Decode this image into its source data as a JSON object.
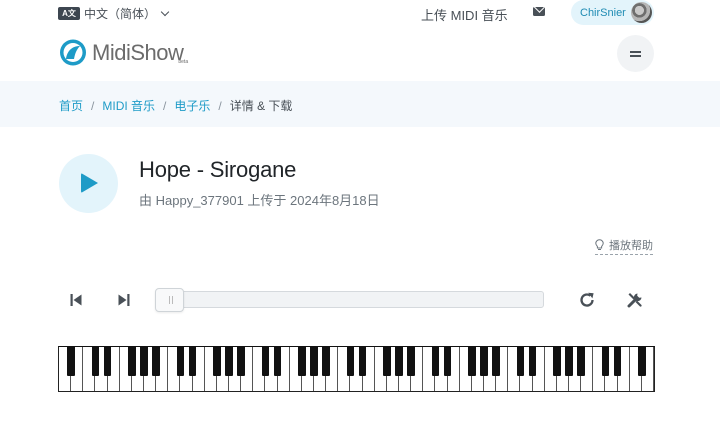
{
  "topbar": {
    "lang_icon": "A文",
    "language": "中文（简体）",
    "upload": "上传 MIDI 音乐",
    "user_name": "ChirSnier"
  },
  "logo": {
    "name": "MidiShow",
    "beta": "beta"
  },
  "breadcrumb": {
    "items": [
      "首页",
      "MIDI 音乐",
      "电子乐"
    ],
    "current": "详情 & 下载"
  },
  "song": {
    "title": "Hope - Sirogane",
    "meta": "由 Happy_377901 上传于 2024年8月18日"
  },
  "help": {
    "label": "播放帮助"
  },
  "player": {
    "progress": 0
  },
  "colors": {
    "accent": "#1e9bc7",
    "accent_light": "#e3f4fb",
    "crumb_bg": "#f4f8fc",
    "text_muted": "#6c757d"
  },
  "icons": {
    "play": "play-icon",
    "prev": "skip-back-icon",
    "next": "skip-forward-icon",
    "repeat": "repeat-icon",
    "tools": "tools-icon",
    "mail": "mail-icon",
    "help": "lightbulb-icon",
    "menu": "menu-icon"
  }
}
